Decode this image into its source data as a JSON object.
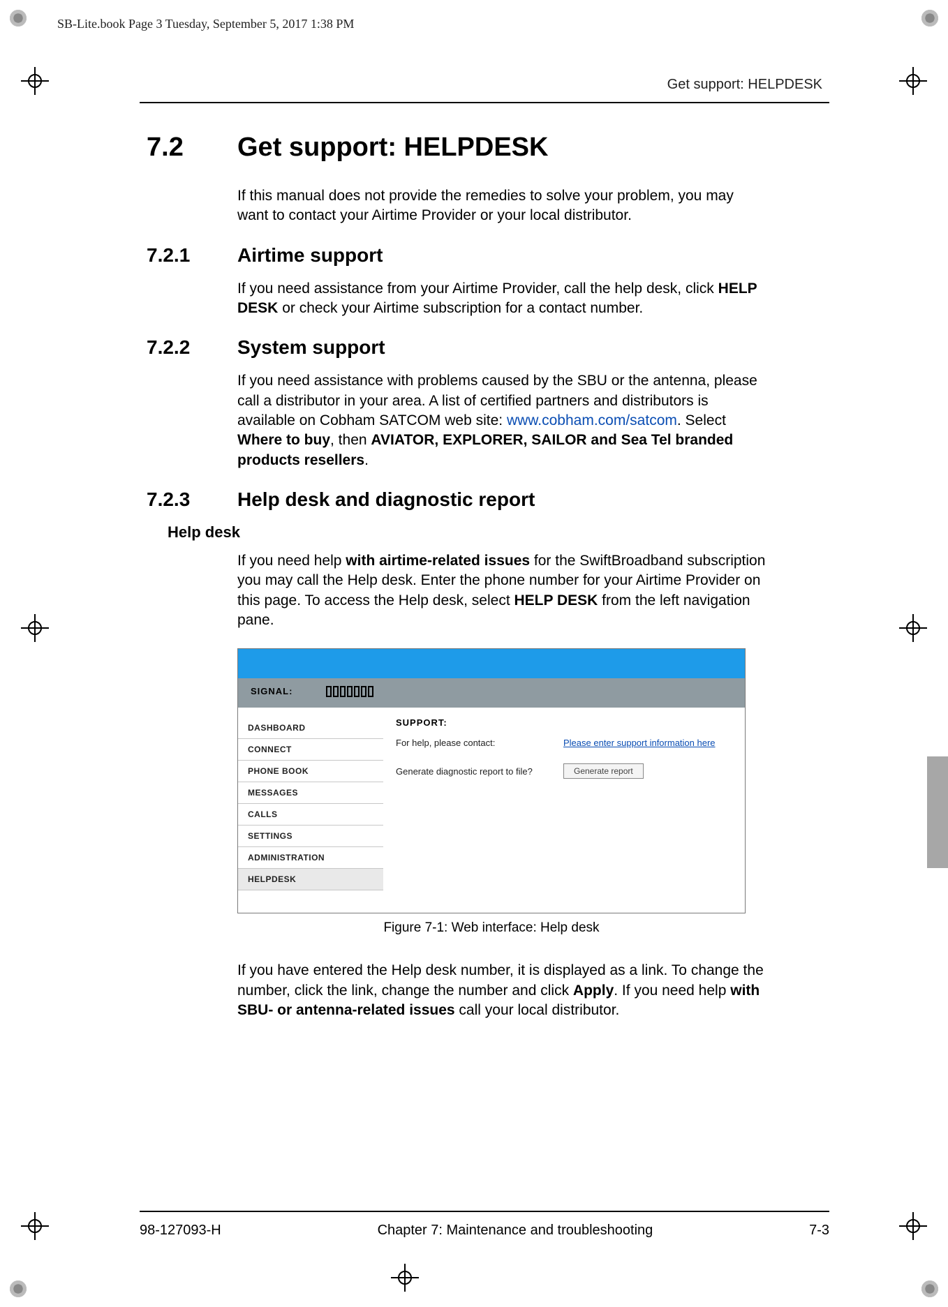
{
  "meta_header": "SB-Lite.book  Page 3  Tuesday, September 5, 2017  1:38 PM",
  "running_head": "Get support: HELPDESK",
  "h1": {
    "num": "7.2",
    "title_a": "Get support: ",
    "title_b": "HELPDESK"
  },
  "intro": "If this manual does not provide the remedies to solve your problem, you may want to contact your Airtime Provider or your local distributor.",
  "s721": {
    "num": "7.2.1",
    "title": "Airtime support",
    "p_a": "If you need assistance from your Airtime Provider, call the help desk, click ",
    "p_b": "HELP DESK",
    "p_c": " or check your Airtime subscription for a contact number."
  },
  "s722": {
    "num": "7.2.2",
    "title": "System support",
    "p_a": "If you need assistance with problems caused by the SBU or the antenna, please call a distributor in your area. A list of certified partners and distributors is available on Cobham SATCOM web site: ",
    "link": "www.cobham.com/satcom",
    "p_b": ". Select ",
    "p_c": "Where to buy",
    "p_d": ", then ",
    "p_e": "AVIATOR, EXPLORER, SAILOR and Sea Tel branded products resellers",
    "p_f": "."
  },
  "s723": {
    "num": "7.2.3",
    "title": "Help desk and diagnostic report",
    "sub": "Help desk",
    "p1_a": "If you need help ",
    "p1_b": "with airtime-related issues",
    "p1_c": " for the SwiftBroadband subscription you may call the Help desk. Enter the phone number for your Airtime Provider on this page. To access the Help desk, select ",
    "p1_d": "HELP DESK",
    "p1_e": " from the left navigation pane.",
    "figcap": "Figure 7-1: Web interface: Help desk",
    "p2_a": "If you have entered the Help desk number, it is displayed as a link. To change the number, click the link, change the number and click ",
    "p2_b": "Apply",
    "p2_c": ". If you need help ",
    "p2_d": "with SBU- or antenna-related issues",
    "p2_e": " call your local distributor."
  },
  "screenshot": {
    "signal_label": "SIGNAL:",
    "nav": [
      "DASHBOARD",
      "CONNECT",
      "PHONE BOOK",
      "MESSAGES",
      "CALLS",
      "SETTINGS",
      "ADMINISTRATION",
      "HELPDESK"
    ],
    "support_title": "SUPPORT:",
    "help_label": "For help, please contact:",
    "help_link": "Please enter support information here",
    "gen_label": "Generate diagnostic report to file?",
    "gen_btn": "Generate report"
  },
  "footer": {
    "left": "98-127093-H",
    "center": "Chapter 7:  Maintenance and troubleshooting",
    "right": "7-3"
  }
}
